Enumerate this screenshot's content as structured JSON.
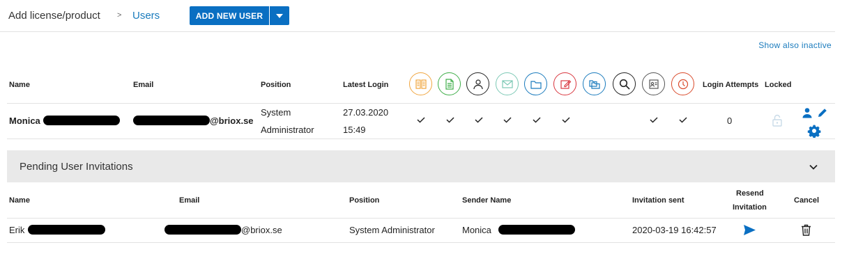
{
  "breadcrumb": {
    "root": "Add license/product",
    "separator": ">",
    "current": "Users"
  },
  "toolbar": {
    "add_user_label": "ADD NEW USER"
  },
  "show_inactive_link": "Show also inactive",
  "users_table": {
    "headers": {
      "name": "Name",
      "email": "Email",
      "position": "Position",
      "latest_login": "Latest Login",
      "login_attempts": "Login Attempts",
      "locked": "Locked"
    },
    "permission_icons": [
      {
        "name": "ledger-book-icon",
        "color": "#f0a640"
      },
      {
        "name": "document-icon",
        "color": "#3fae49"
      },
      {
        "name": "users-group-icon",
        "color": "#222222"
      },
      {
        "name": "envelope-icon",
        "color": "#7cc9b5"
      },
      {
        "name": "folder-icon",
        "color": "#1a7bbd"
      },
      {
        "name": "edit-note-icon",
        "color": "#d9363e"
      },
      {
        "name": "folders-icon",
        "color": "#1a7bbd"
      },
      {
        "name": "magnifier-icon",
        "color": "#222222"
      },
      {
        "name": "id-card-icon",
        "color": "#555555"
      },
      {
        "name": "clock-icon",
        "color": "#d94a2b"
      }
    ],
    "rows": [
      {
        "name": "Monica",
        "email": "@briox.se",
        "position_line1": "System",
        "position_line2": "Administrator",
        "login_date": "27.03.2020",
        "login_time": "15:49",
        "login_attempts": "0"
      }
    ]
  },
  "pending": {
    "title": "Pending User Invitations",
    "headers": {
      "name": "Name",
      "email": "Email",
      "position": "Position",
      "sender": "Sender Name",
      "sent": "Invitation sent",
      "resend_line1": "Resend",
      "resend_line2": "Invitation",
      "cancel": "Cancel"
    },
    "rows": [
      {
        "name": "Erik",
        "email": "@briox.se",
        "position": "System Administrator",
        "sender": "Monica",
        "sent": "2020-03-19 16:42:57"
      }
    ]
  }
}
